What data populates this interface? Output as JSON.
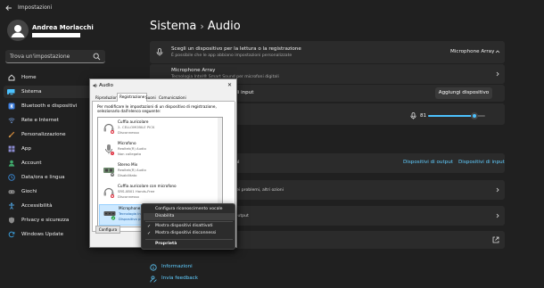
{
  "window": {
    "title": "Impostazioni"
  },
  "user": {
    "name": "Andrea Morlacchi"
  },
  "search": {
    "placeholder": "Trova un'impostazione"
  },
  "sidebar": {
    "items": [
      {
        "label": "Home",
        "color": "#e8e8e8"
      },
      {
        "label": "Sistema",
        "color": "#4cc2ff"
      },
      {
        "label": "Bluetooth e dispositivi",
        "color": "#3d7fe0"
      },
      {
        "label": "Rete e Internet",
        "color": "#6a8fc7"
      },
      {
        "label": "Personalizzazione",
        "color": "#d48a3a"
      },
      {
        "label": "App",
        "color": "#8b8bd0"
      },
      {
        "label": "Account",
        "color": "#3fa86b"
      },
      {
        "label": "Data/ora e lingua",
        "color": "#3a8ad6"
      },
      {
        "label": "Giochi",
        "color": "#8c8c8c"
      },
      {
        "label": "Accessibilità",
        "color": "#4fa3e0"
      },
      {
        "label": "Privacy e sicurezza",
        "color": "#8a8a8a"
      },
      {
        "label": "Windows Update",
        "color": "#3a9ad6"
      }
    ]
  },
  "main": {
    "breadcrumb_parent": "Sistema",
    "breadcrumb_sep": "›",
    "breadcrumb_current": "Audio",
    "input_card": {
      "title": "Scegli un dispositivo per la lettura o la registrazione",
      "subtitle": "È possibile che le app abbiano impostazioni personalizzate",
      "value": "Microphone Array"
    },
    "mic_card": {
      "title": "Microphone Array",
      "subtitle": "Tecnologia Intel® Smart Sound per microfoni digitali"
    },
    "add_row": {
      "label_partial": "o di input",
      "button": "Aggiungi dispositivo"
    },
    "volume": {
      "value": "81",
      "level_percent": 81
    },
    "options": {
      "label_partial": "umi",
      "link_output": "Dispositivi di output",
      "link_input": "Dispositivi di input"
    },
    "troubleshoot": {
      "label_partial": "e dei problemi, altri ozioni"
    },
    "output_row": {
      "label_partial": "di output"
    },
    "footer": {
      "info": "Informazioni",
      "feedback": "Invia feedback"
    }
  },
  "dialog": {
    "title": "Audio",
    "close": "✕",
    "tabs": [
      "Riproduzione",
      "Registrazione",
      "Suoni",
      "Comunicazioni"
    ],
    "selected_tab": 1,
    "instructions": "Per modificare le impostazioni di un dispositivo di registrazione, selezionarlo dall'elenco seguente:",
    "devices": [
      {
        "name": "Cuffia auricolare",
        "detail": "2- CELLOMOBILE PICK",
        "status": "Disconnesso",
        "icon": "headset-icon"
      },
      {
        "name": "Microfono",
        "detail": "Realtek(R) Audio",
        "status": "Non collegato",
        "icon": "microphone-icon"
      },
      {
        "name": "Stereo Mix",
        "detail": "Realtek(R) Audio",
        "status": "Disabilitato",
        "icon": "stereo-mix-icon"
      },
      {
        "name": "Cuffia auricolare con microfono",
        "detail": "SRS-XB01 Hands-Free",
        "status": "Disconnesso",
        "icon": "headset-icon"
      },
      {
        "name": "Microphone Array",
        "detail": "Tecnologia Intel® Smart Sound per microfoni digitali",
        "status": "Dispositivo pred",
        "icon": "mic-array-icon"
      }
    ],
    "configure_button": "Configura"
  },
  "context_menu": {
    "items": [
      {
        "label": "Configura riconoscimento vocale",
        "checked": false
      },
      {
        "label": "Disabilita",
        "checked": false
      },
      {
        "label": "Mostra dispositivi disattivati",
        "checked": true
      },
      {
        "label": "Mostra dispositivi disconnessi",
        "checked": true
      },
      {
        "label": "Proprietà",
        "checked": false
      }
    ],
    "check_mark": "✓"
  }
}
